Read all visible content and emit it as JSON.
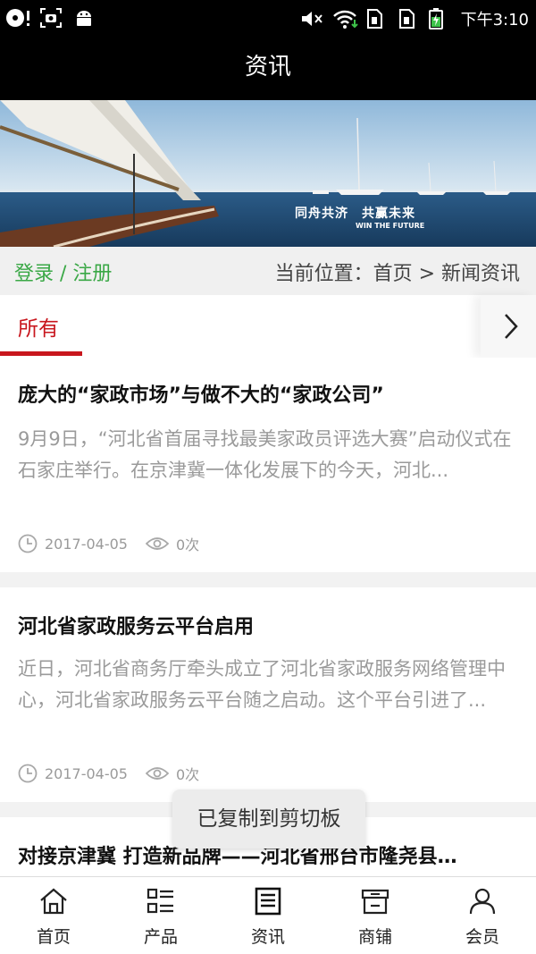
{
  "status_bar": {
    "time": "下午3:10",
    "icons_left": [
      "record-icon",
      "screenshot-icon",
      "android-icon"
    ],
    "icons_right": [
      "mute-icon",
      "wifi-icon",
      "sim1-icon",
      "sim2-icon",
      "battery-charging-icon"
    ]
  },
  "header": {
    "title": "资讯"
  },
  "banner": {
    "slogan": "同舟共济　共赢未来",
    "slogan_en": "WIN THE FUTURE"
  },
  "location_bar": {
    "login_label": "登录 / 注册",
    "breadcrumb": "当前位置：首页 > 新闻资讯"
  },
  "tabs": {
    "active_label": "所有",
    "next_icon": "chevron-right-icon"
  },
  "articles": [
    {
      "title": "庞大的“家政市场”与做不大的“家政公司”",
      "summary": "9月9日，“河北省首届寻找最美家政员评选大赛”启动仪式在石家庄举行。在京津冀一体化发展下的今天，河北...",
      "date": "2017-04-05",
      "views": "0次"
    },
    {
      "title": "河北省家政服务云平台启用",
      "summary": "近日，河北省商务厅牵头成立了河北省家政服务网络管理中心，河北省家政服务云平台随之启动。这个平台引进了...",
      "date": "2017-04-05",
      "views": "0次"
    },
    {
      "title": "对接京津冀 打造新品牌——河北省邢台市隆尧县…"
    }
  ],
  "toast": {
    "text": "已复制到剪切板"
  },
  "bottom_nav": [
    {
      "label": "首页",
      "icon": "home-icon"
    },
    {
      "label": "产品",
      "icon": "list-icon"
    },
    {
      "label": "资讯",
      "icon": "news-icon"
    },
    {
      "label": "商铺",
      "icon": "shop-icon"
    },
    {
      "label": "会员",
      "icon": "user-icon"
    }
  ],
  "colors": {
    "accent_red": "#c8161d",
    "login_green": "#3aa846",
    "header_bg": "#000000"
  }
}
